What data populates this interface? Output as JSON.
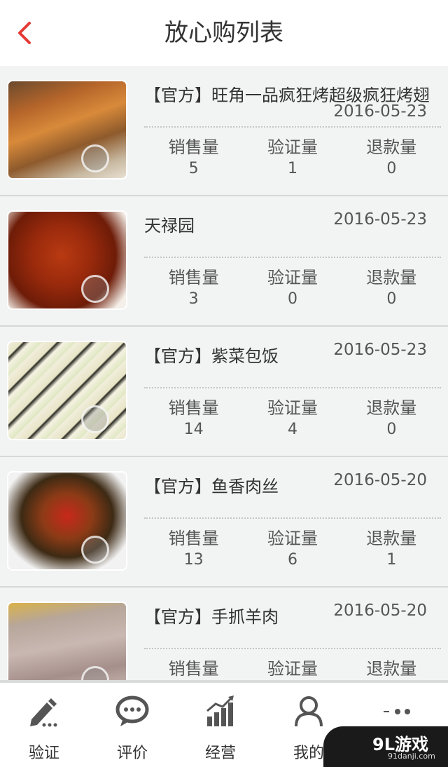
{
  "header": {
    "title": "放心购列表",
    "back_icon": "chevron-left-icon"
  },
  "colors": {
    "accent": "#e53935",
    "icon_gray": "#555555"
  },
  "items": [
    {
      "name": "【官方】旺角一品疯狂烤超级疯狂烤翅",
      "date": "2016-05-23",
      "sales_label": "销售量",
      "sales": "5",
      "verified_label": "验证量",
      "verified": "1",
      "refund_label": "退款量",
      "refund": "0"
    },
    {
      "name": "天禄园",
      "date": "2016-05-23",
      "sales_label": "销售量",
      "sales": "3",
      "verified_label": "验证量",
      "verified": "0",
      "refund_label": "退款量",
      "refund": "0"
    },
    {
      "name": "【官方】紫菜包饭",
      "date": "2016-05-23",
      "sales_label": "销售量",
      "sales": "14",
      "verified_label": "验证量",
      "verified": "4",
      "refund_label": "退款量",
      "refund": "0"
    },
    {
      "name": "【官方】鱼香肉丝",
      "date": "2016-05-20",
      "sales_label": "销售量",
      "sales": "13",
      "verified_label": "验证量",
      "verified": "6",
      "refund_label": "退款量",
      "refund": "1"
    },
    {
      "name": "【官方】手抓羊肉",
      "date": "2016-05-20",
      "sales_label": "销售量",
      "sales": "",
      "verified_label": "验证量",
      "verified": "",
      "refund_label": "退款量",
      "refund": ""
    }
  ],
  "tabbar": {
    "verify": "验证",
    "review": "评价",
    "business": "经营",
    "mine": "我的"
  },
  "watermark": {
    "brand": "9L游戏",
    "site": "91danji.com"
  }
}
